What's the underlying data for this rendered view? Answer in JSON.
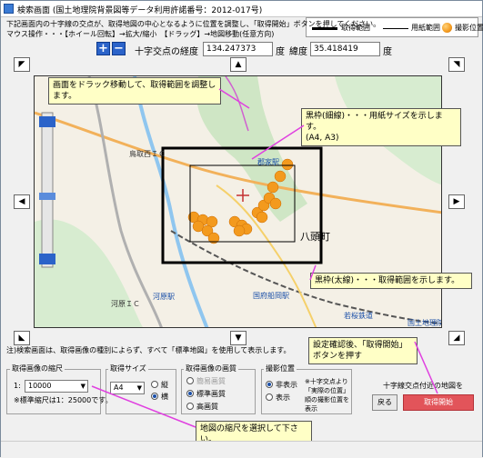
{
  "window": {
    "title": "検索画面 (国土地理院背景図等データ利用許諾番号：2012-017号)"
  },
  "legend": {
    "range_label": "取得範囲",
    "paper_label": "用紙範囲",
    "photo_label": "撮影位置"
  },
  "hint": {
    "line1": "下記画面内の十字線の交点が、取得地図の中心となるように位置を調整し、「取得開始」ボタンを押してください。",
    "line2": "マウス操作・・・【ホイール回転】→拡大/縮小　【ドラッグ】→地図移動(任意方向)"
  },
  "zoom": {
    "in_label": "+",
    "out_label": "−"
  },
  "coords": {
    "lon_label": "十字交点の経度",
    "lon_value": "134.247373",
    "deg1": "度",
    "lat_label": "緯度",
    "lat_value": "35.418419",
    "deg2": "度"
  },
  "map": {
    "labels": {
      "ic1": "鳥取西ＩＣ",
      "ic2": "河原ＩＣ",
      "town": "八頭町",
      "station1": "河原駅",
      "station2": "国府船岡駅",
      "station3": "郡家駅",
      "station4": "若桜鉄道",
      "copyright": "国土地理院"
    }
  },
  "callouts": {
    "drag": "画面をドラック移動して、取得範囲を調整します。",
    "thin": "黒枠(細線)・・・用紙サイズを示します。\n(A4, A3)",
    "thick": "黒枠(太線)・・・取得範囲を示します。",
    "confirm": "設定確認後、「取得開始」ボタンを押す",
    "scale": "地図の縮尺を選択して下さい。"
  },
  "note": "注)検索画面は、取得画像の種別によらず、すべて「標準地図」を使用して表示します。",
  "scale_section": {
    "title": "取得画像の縮尺",
    "prefix": "1:",
    "value": "10000",
    "note": "※標準縮尺は1：25000です。"
  },
  "size_section": {
    "title": "取得サイズ",
    "value": "A4",
    "opt1": "縦",
    "opt2": "横"
  },
  "quality_section": {
    "title": "取得画像の画質",
    "opt1": "簡易画質",
    "opt2": "標準画質",
    "opt3": "高画質"
  },
  "pos_section": {
    "title": "撮影位置",
    "opt1": "非表示",
    "opt2": "表示",
    "note": "※十字交点より「実際の位置」順の撮影位置を表示"
  },
  "actions": {
    "near_note": "十字線交点付近の地図を",
    "back": "戻る",
    "start": "取得開始"
  }
}
